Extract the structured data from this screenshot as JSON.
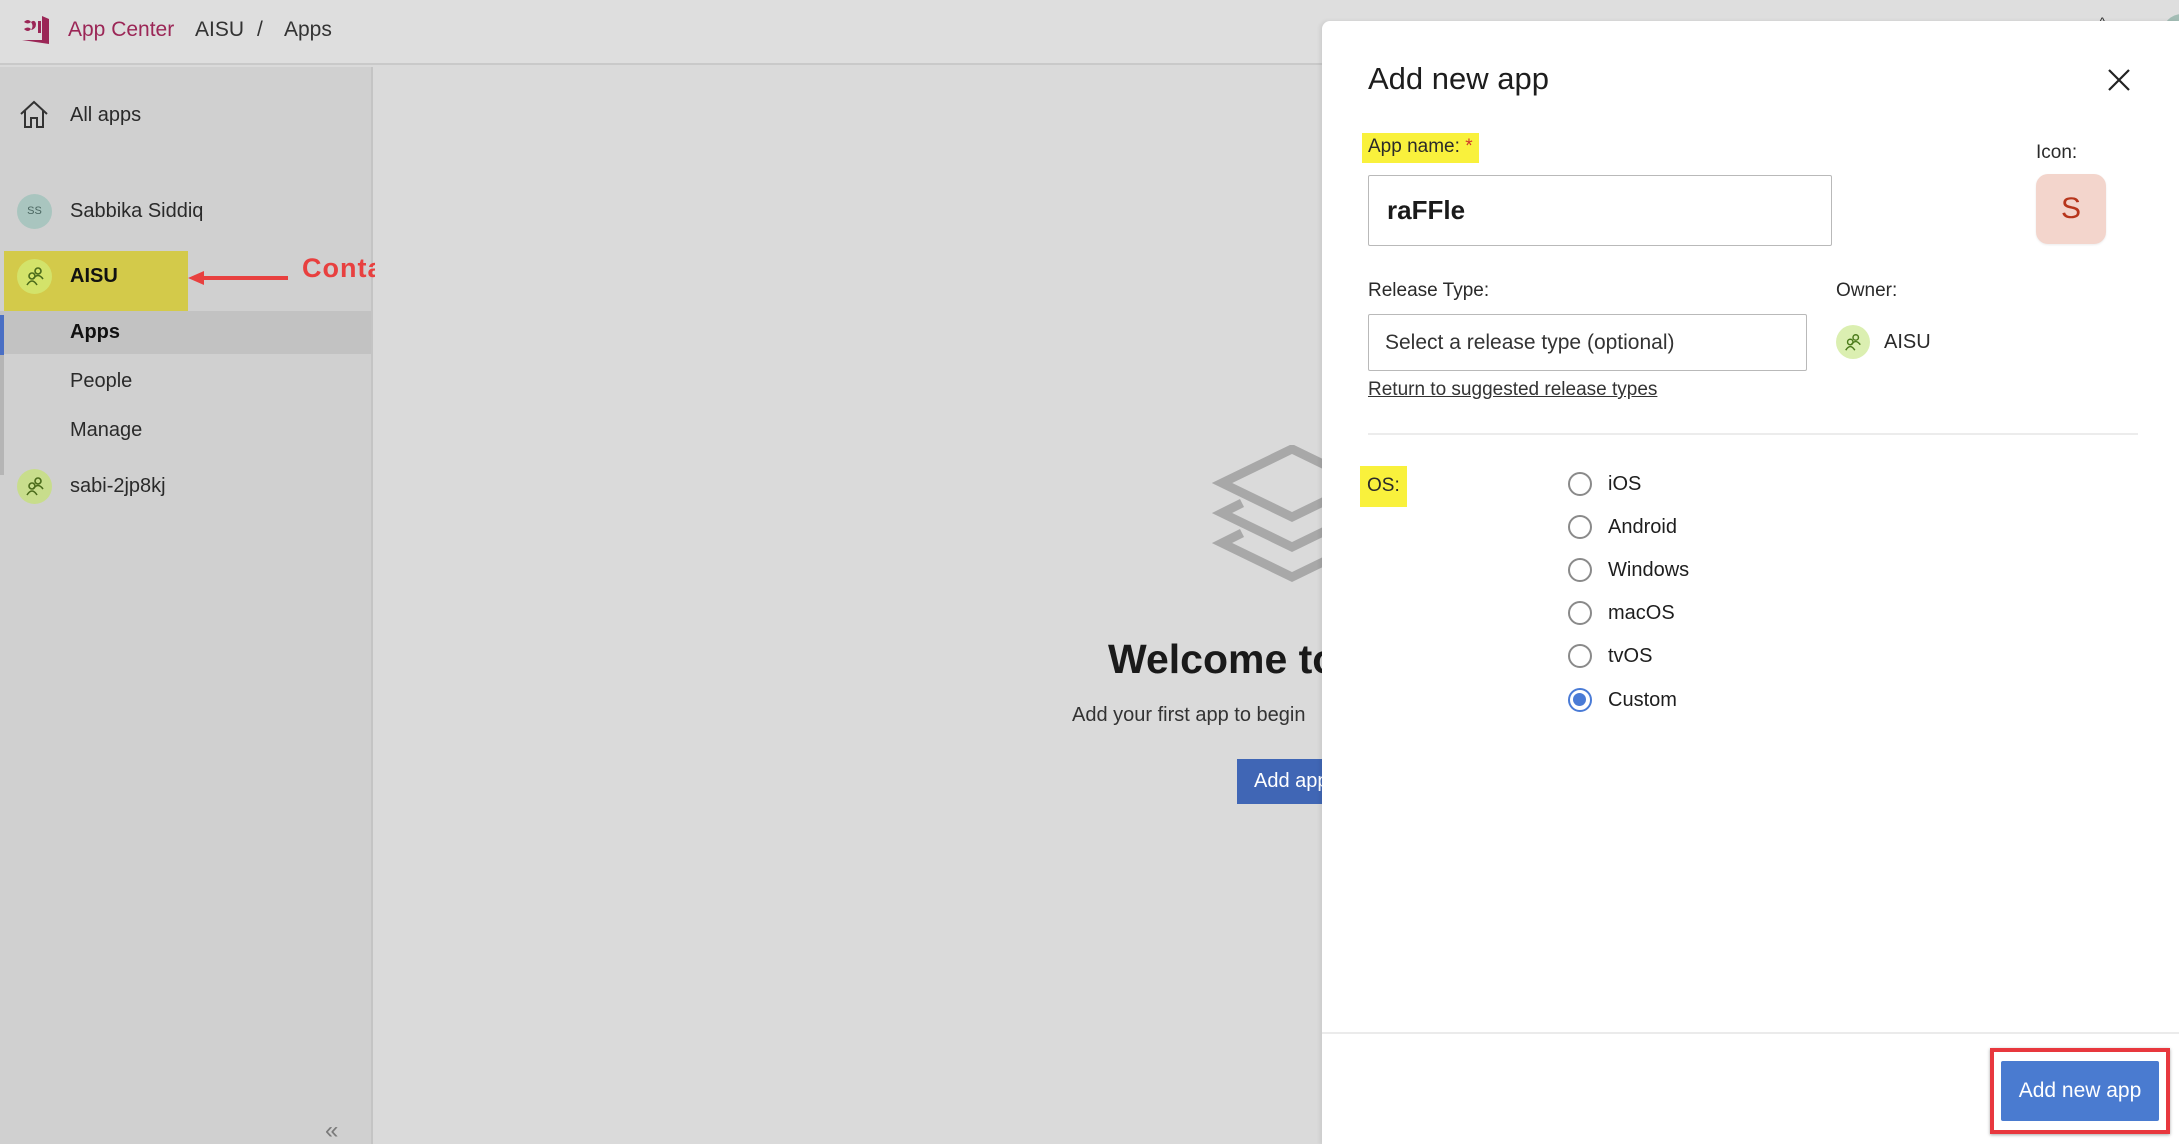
{
  "header": {
    "brand": "App Center",
    "breadcrumb": [
      "AISU",
      "Apps"
    ],
    "separator": "/",
    "brand_color": "#9b2656"
  },
  "sidebar": {
    "all_apps": "All apps",
    "user": {
      "initials": "SS",
      "name": "Sabbika Siddiq"
    },
    "org_active": {
      "name": "AISU"
    },
    "sub_items": [
      {
        "label": "Apps",
        "active": true
      },
      {
        "label": "People",
        "active": false
      },
      {
        "label": "Manage",
        "active": false
      }
    ],
    "org_other": {
      "name": "sabi-2jp8kj"
    },
    "collapse_glyph": "«"
  },
  "annotation": {
    "text": "Container",
    "color": "#e8403f",
    "highlight_color": "#d3ca4a"
  },
  "main": {
    "welcome_title": "Welcome to",
    "welcome_subtitle": "Add your first app to begin",
    "add_app_button": "Add app"
  },
  "panel": {
    "title": "Add new app",
    "close_label": "Close",
    "app_name_label": "App name:",
    "required_mark": "*",
    "app_name_value": "raFFle",
    "icon_label": "Icon:",
    "icon_letter": "S",
    "release_type_label": "Release Type:",
    "release_type_placeholder": "Select a release type (optional)",
    "owner_label": "Owner:",
    "owner_name": "AISU",
    "return_link": "Return to suggested release types",
    "os_label": "OS:",
    "os_options": [
      {
        "label": "iOS",
        "selected": false
      },
      {
        "label": "Android",
        "selected": false
      },
      {
        "label": "Windows",
        "selected": false
      },
      {
        "label": "macOS",
        "selected": false
      },
      {
        "label": "tvOS",
        "selected": false
      },
      {
        "label": "Custom",
        "selected": true
      }
    ],
    "submit_button": "Add new app",
    "accent_color": "#4a7bd0"
  }
}
